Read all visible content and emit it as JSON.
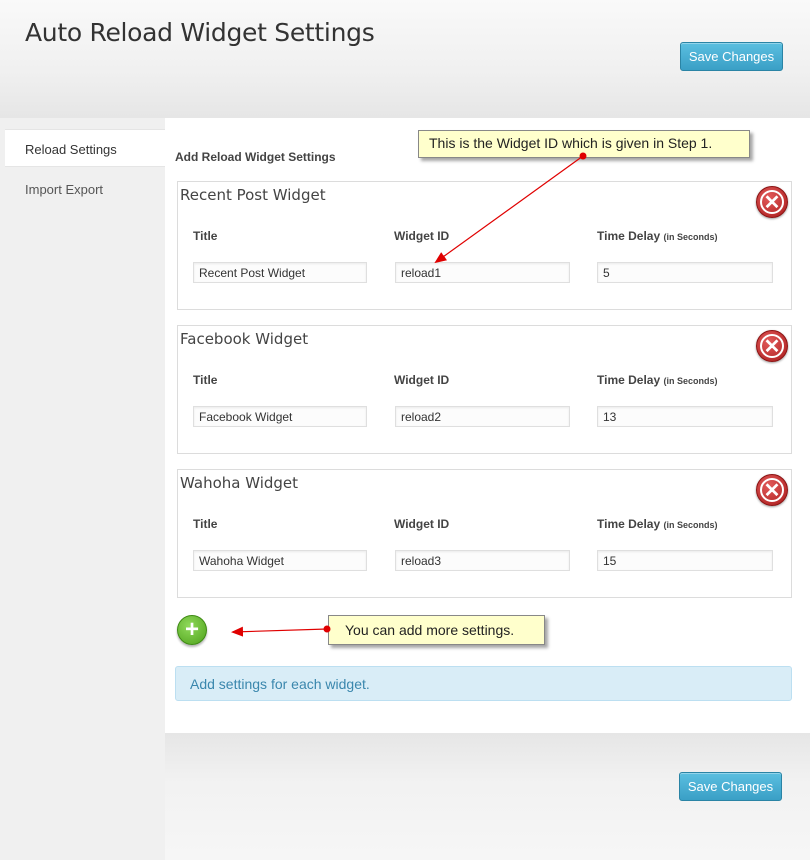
{
  "header": {
    "title": "Auto Reload Widget Settings",
    "save_label": "Save Changes"
  },
  "sidebar": {
    "items": [
      {
        "label": "Reload Settings",
        "active": true
      },
      {
        "label": "Import Export",
        "active": false
      }
    ]
  },
  "main": {
    "section_heading": "Add Reload Widget Settings",
    "labels": {
      "title": "Title",
      "widget_id": "Widget ID",
      "time_delay": "Time Delay",
      "time_delay_unit": "(in Seconds)"
    },
    "widgets": [
      {
        "name": "Recent Post Widget",
        "title": "Recent Post Widget",
        "widget_id": "reload1",
        "time_delay": "5"
      },
      {
        "name": "Facebook Widget",
        "title": "Facebook Widget",
        "widget_id": "reload2",
        "time_delay": "13"
      },
      {
        "name": "Wahoha Widget",
        "title": "Wahoha Widget",
        "widget_id": "reload3",
        "time_delay": "15"
      }
    ],
    "info_message": "Add settings for each widget."
  },
  "footer": {
    "save_label": "Save Changes"
  },
  "annotations": {
    "widget_id_note": "This is the Widget ID which is given in Step 1.",
    "add_more_note": "You can add more settings."
  },
  "colors": {
    "accent": "#3a9fc6",
    "delete": "#c0272d",
    "add": "#5cb22a",
    "info_bg": "#d9edf7",
    "callout_bg": "#ffffcc",
    "arrow": "#e00000"
  },
  "icons": {
    "delete": "close-circle-icon",
    "add": "plus-circle-icon"
  }
}
